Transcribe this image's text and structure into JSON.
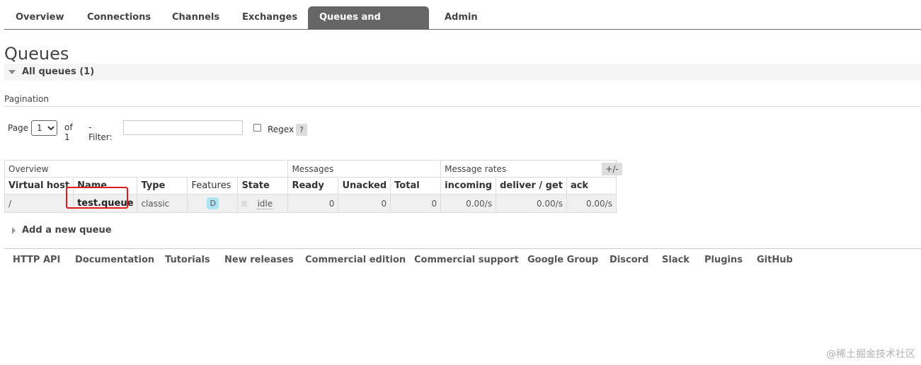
{
  "nav": {
    "tabs": [
      {
        "label": "Overview"
      },
      {
        "label": "Connections"
      },
      {
        "label": "Channels"
      },
      {
        "label": "Exchanges"
      },
      {
        "label": "Queues and Streams",
        "active": true
      },
      {
        "label": "Admin"
      }
    ]
  },
  "page": {
    "title": "Queues",
    "section_label": "All queues (1)"
  },
  "pagination": {
    "title": "Pagination",
    "page_label": "Page",
    "page_value": "1",
    "of_label": "of 1",
    "filter_label": "- Filter:",
    "filter_value": "",
    "regex_label": "Regex",
    "help_label": "?"
  },
  "table": {
    "groups": [
      "Overview",
      "Messages",
      "Message rates"
    ],
    "columns": [
      "Virtual host",
      "Name",
      "Type",
      "Features",
      "State",
      "Ready",
      "Unacked",
      "Total",
      "incoming",
      "deliver / get",
      "ack"
    ],
    "rows": [
      {
        "vhost": "/",
        "name": "test.queue",
        "type": "classic",
        "features": "D",
        "state": "idle",
        "ready": "0",
        "unacked": "0",
        "total": "0",
        "incoming": "0.00/s",
        "deliver_get": "0.00/s",
        "ack": "0.00/s"
      }
    ],
    "plusminus": "+/-"
  },
  "add_queue_label": "Add a new queue",
  "footer": {
    "links": [
      "HTTP API",
      "Documentation",
      "Tutorials",
      "New releases",
      "Commercial edition",
      "Commercial support",
      "Google Group",
      "Discord",
      "Slack",
      "Plugins",
      "GitHub"
    ]
  },
  "watermark": "@稀土掘金技术社区",
  "colors": {
    "active_tab_bg": "#666666",
    "feature_badge": "#aee4f2",
    "highlight": "#e01a1a"
  }
}
